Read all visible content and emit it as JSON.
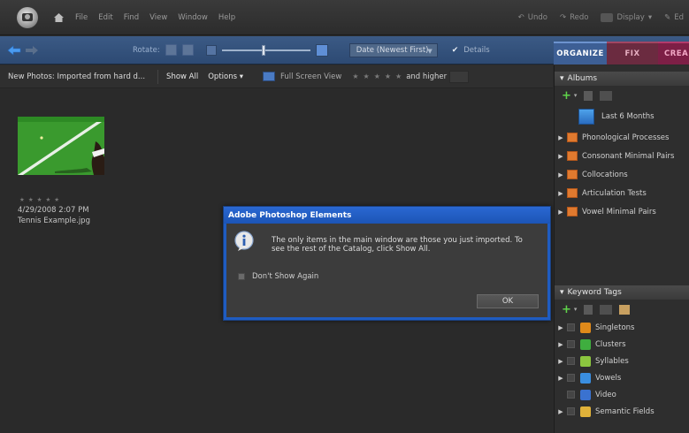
{
  "menubar": {
    "menus": [
      "File",
      "Edit",
      "Find",
      "View",
      "Window",
      "Help"
    ],
    "undo_label": "Undo",
    "redo_label": "Redo",
    "display_label": "Display",
    "edit_label": "Ed"
  },
  "toolbar": {
    "rotate_label": "Rotate:",
    "sort_value": "Date (Newest First)",
    "details_label": "Details",
    "tabs": {
      "organize": "ORGANIZE",
      "fix": "FIX",
      "create": "CREA"
    }
  },
  "filterbar": {
    "title": "New Photos: Imported from hard d...",
    "show_all": "Show All",
    "options": "Options",
    "full_screen": "Full Screen View",
    "stars": "★★★★★",
    "and_higher": "and higher"
  },
  "photo": {
    "stars": "★★★★★",
    "date": "4/29/2008 2:07 PM",
    "filename": "Tennis Example.jpg"
  },
  "dialog": {
    "title": "Adobe Photoshop Elements",
    "message": "The only items in the main window are those you just imported. To see the rest of the Catalog, click Show All.",
    "dont_show": "Don't Show Again",
    "ok": "OK"
  },
  "albums": {
    "header": "Albums",
    "last6": "Last 6 Months",
    "items": [
      "Phonological Processes",
      "Consonant Minimal Pairs",
      "Collocations",
      "Articulation Tests",
      "Vowel Minimal Pairs"
    ]
  },
  "keywords": {
    "header": "Keyword Tags",
    "items": [
      {
        "label": "Singletons",
        "color": "#e08a1a"
      },
      {
        "label": "Clusters",
        "color": "#3fae3f"
      },
      {
        "label": "Syllables",
        "color": "#8cc63f"
      },
      {
        "label": "Vowels",
        "color": "#3a8ee0"
      },
      {
        "label": "Video",
        "color": "#3a72d0"
      },
      {
        "label": "Semantic Fields",
        "color": "#e0b23a"
      }
    ]
  }
}
